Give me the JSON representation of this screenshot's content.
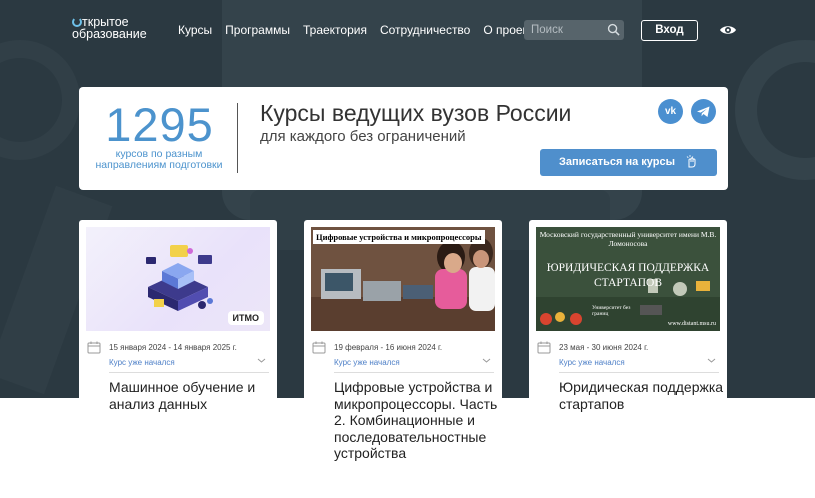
{
  "header": {
    "logo_line1": "ткрытое",
    "logo_line2": "образование",
    "nav": [
      "Курсы",
      "Программы",
      "Траектория",
      "Сотрудничество",
      "О проекте"
    ],
    "search_placeholder": "Поиск",
    "login_label": "Вход"
  },
  "banner": {
    "count": "1295",
    "count_sub": "курсов по разным направлениям подготовки",
    "title": "Курсы ведущих вузов России",
    "subtitle": "для каждого без ограничений",
    "vk_label": "vk",
    "signup_label": "Записаться на курсы"
  },
  "cards": [
    {
      "image_logo": "ИТМО",
      "dates": "15 января 2024 - 14 января 2025 г.",
      "status": "Курс уже начался",
      "title": "Машинное обучение и анализ данных"
    },
    {
      "image_label": "Цифровые устройства и микропроцессоры",
      "dates": "19 февраля - 16 июня 2024 г.",
      "status": "Курс уже начался",
      "title": "Цифровые устройства и микропроцессоры. Часть 2. Комбинационные и последовательностные устройства"
    },
    {
      "image_top": "Московский государственный университет имени М.В. Ломоносова",
      "image_main": "ЮРИДИЧЕСКАЯ ПОДДЕРЖКА СТАРТАПОВ",
      "image_badge": "Университет без границ",
      "image_url": "www.distant.msu.ru",
      "dates": "23 мая - 30 июня 2024 г.",
      "status": "Курс уже начался",
      "title": "Юридическая поддержка стартапов"
    }
  ],
  "colors": {
    "hero_bg": "#2b3941",
    "accent": "#4f8fcc",
    "status_link": "#4d7fc7"
  },
  "icons": [
    "search-icon",
    "eye-icon",
    "vk-icon",
    "telegram-icon",
    "pointer-hand-icon",
    "calendar-icon",
    "chevron-down-icon"
  ]
}
